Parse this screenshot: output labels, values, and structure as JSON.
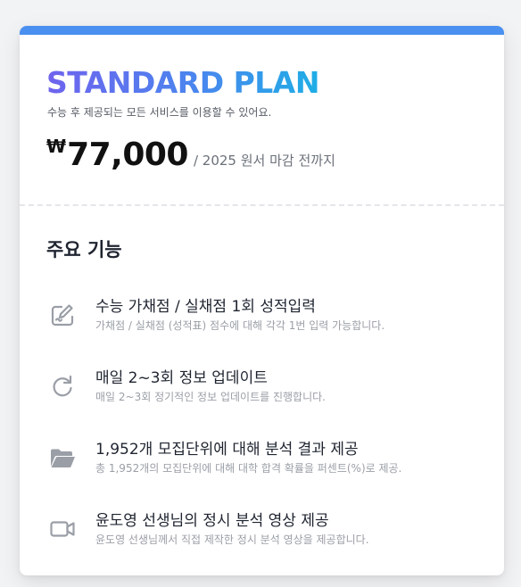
{
  "plan": {
    "title": "STANDARD PLAN",
    "subtitle": "수능 후 제공되는 모든 서비스를 이용할 수 있어요.",
    "currency": "₩",
    "amount": "77,000",
    "price_suffix": "/ 2025 원서 마감 전까지"
  },
  "features": {
    "heading": "주요 기능",
    "items": [
      {
        "icon": "edit-icon",
        "title": "수능 가채점 / 실채점 1회 성적입력",
        "description": "가채점 / 실채점 (성적표) 점수에 대해 각각 1번 입력 가능합니다."
      },
      {
        "icon": "refresh-icon",
        "title": "매일 2~3회 정보 업데이트",
        "description": "매일 2~3회 정기적인 정보 업데이트를 진행합니다."
      },
      {
        "icon": "folder-open-icon",
        "title": "1,952개 모집단위에 대해 분석 결과 제공",
        "description": "총 1,952개의 모집단위에 대해 대학 합격 확률을 퍼센트(%)로 제공."
      },
      {
        "icon": "video-icon",
        "title": "윤도영 선생님의 정시 분석 영상 제공",
        "description": "윤도영 선생님께서 직접 제작한 정시 분석 영상을 제공합니다."
      }
    ]
  },
  "colors": {
    "accent_bar": "#4a90f0",
    "title_gradient_start": "#6f63ee",
    "title_gradient_end": "#1faee6",
    "icon_gray": "#9a9ea6"
  }
}
